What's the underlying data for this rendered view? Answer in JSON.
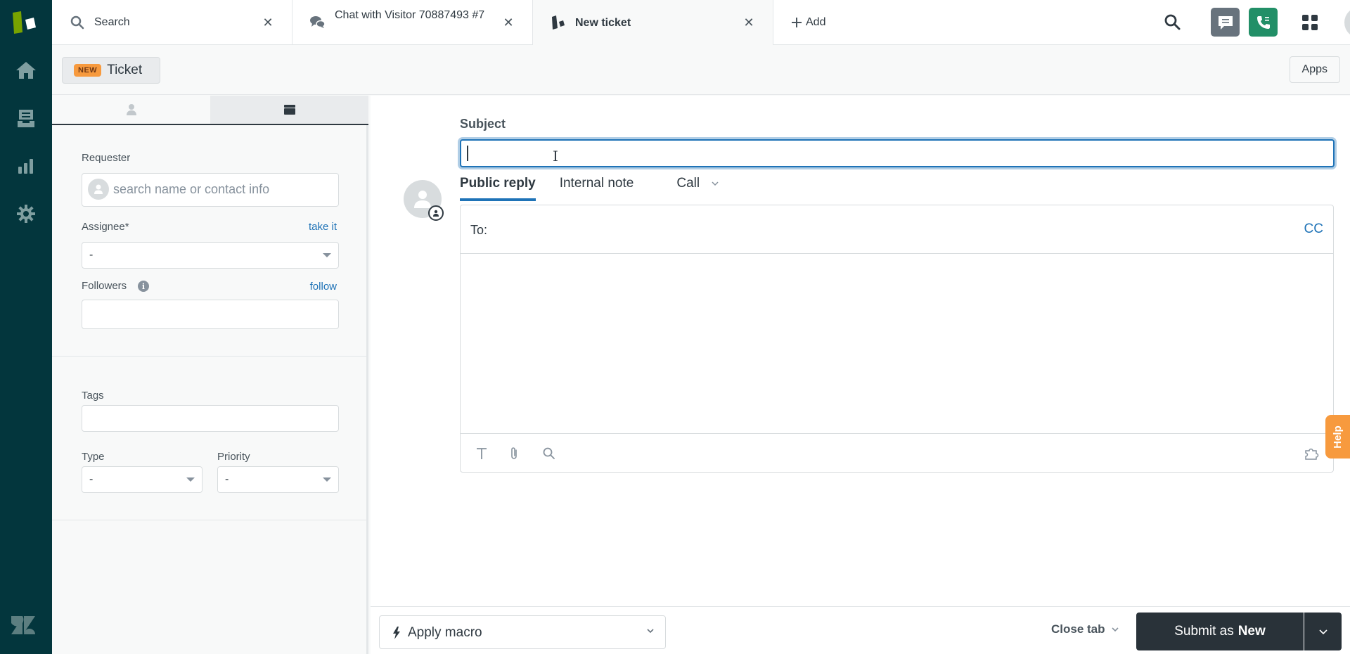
{
  "nav": {
    "items": [
      {
        "name": "home",
        "icon": "home-icon"
      },
      {
        "name": "views",
        "icon": "inbox-icon"
      },
      {
        "name": "reporting",
        "icon": "bar-chart-icon"
      },
      {
        "name": "admin",
        "icon": "gear-icon"
      }
    ]
  },
  "tabs": [
    {
      "label": "Search",
      "icon": "search-icon"
    },
    {
      "label": "Chat with Visitor 70887493 #7",
      "icon": "chat-bubbles-icon"
    },
    {
      "label": "New ticket",
      "icon": "ticket-icon",
      "active": true
    }
  ],
  "add_tab_label": "Add",
  "header_actions": [
    "search-icon",
    "chat-icon",
    "talk-phone-icon",
    "products-grid-icon",
    "user-avatar"
  ],
  "subheader": {
    "badge": "NEW",
    "title": "Ticket",
    "apps_label": "Apps"
  },
  "left_panel": {
    "tabs": [
      {
        "icon": "user-icon",
        "active": false
      },
      {
        "icon": "ticket-card-icon",
        "active": true
      }
    ],
    "requester": {
      "label": "Requester",
      "placeholder": "search name or contact info",
      "value": ""
    },
    "assignee": {
      "label": "Assignee*",
      "link": "take it",
      "value": "-"
    },
    "followers": {
      "label": "Followers",
      "link": "follow",
      "value": ""
    },
    "tags": {
      "label": "Tags",
      "value": ""
    },
    "type": {
      "label": "Type",
      "value": "-"
    },
    "priority": {
      "label": "Priority",
      "value": "-"
    }
  },
  "main": {
    "subject_label": "Subject",
    "subject_value": "",
    "reply_tabs": [
      {
        "label": "Public reply",
        "active": true
      },
      {
        "label": "Internal note",
        "active": false
      },
      {
        "label": "Call",
        "active": false,
        "has_dropdown": true
      }
    ],
    "to_label": "To:",
    "cc_label": "CC",
    "body_value": "",
    "toolbar": [
      "text-format-icon",
      "attachment-icon",
      "knowledge-search-icon",
      "apps-puzzle-icon"
    ]
  },
  "help_label": "Help",
  "footer": {
    "macro_label": "Apply macro",
    "close_tab_label": "Close tab",
    "submit_prefix": "Submit as",
    "submit_status": "New"
  },
  "colors": {
    "nav_bg": "#03363d",
    "accent_blue": "#1f73b7",
    "badge_orange": "#f79a3e",
    "talk_green": "#228f67",
    "submit_dark": "#293239"
  }
}
